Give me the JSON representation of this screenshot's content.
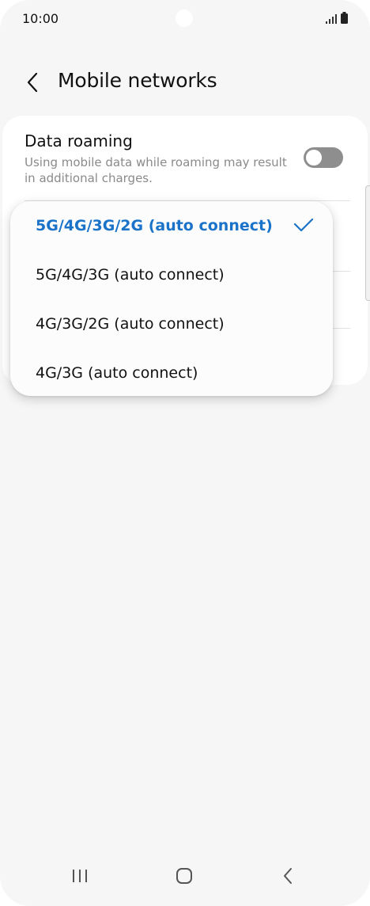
{
  "status_bar": {
    "time": "10:00",
    "icons": [
      "signal-icon",
      "battery-icon"
    ]
  },
  "header": {
    "title": "Mobile networks",
    "back_icon": "chevron-left-icon"
  },
  "setting": {
    "title": "Data roaming",
    "description": "Using mobile data while roaming may result in additional charges.",
    "toggle_on": false
  },
  "network_mode_popup": {
    "options": [
      {
        "label": "5G/4G/3G/2G (auto connect)",
        "selected": true
      },
      {
        "label": "5G/4G/3G (auto connect)",
        "selected": false
      },
      {
        "label": "4G/3G/2G (auto connect)",
        "selected": false
      },
      {
        "label": "4G/3G (auto connect)",
        "selected": false
      }
    ],
    "check_icon": "checkmark-icon"
  },
  "nav_bar": {
    "icons": [
      "recent-apps-icon",
      "home-icon",
      "back-icon"
    ]
  },
  "colors": {
    "accent": "#1a73c8",
    "background": "#f6f6f6",
    "card": "#ffffff",
    "secondary_text": "#8a8a8a"
  }
}
